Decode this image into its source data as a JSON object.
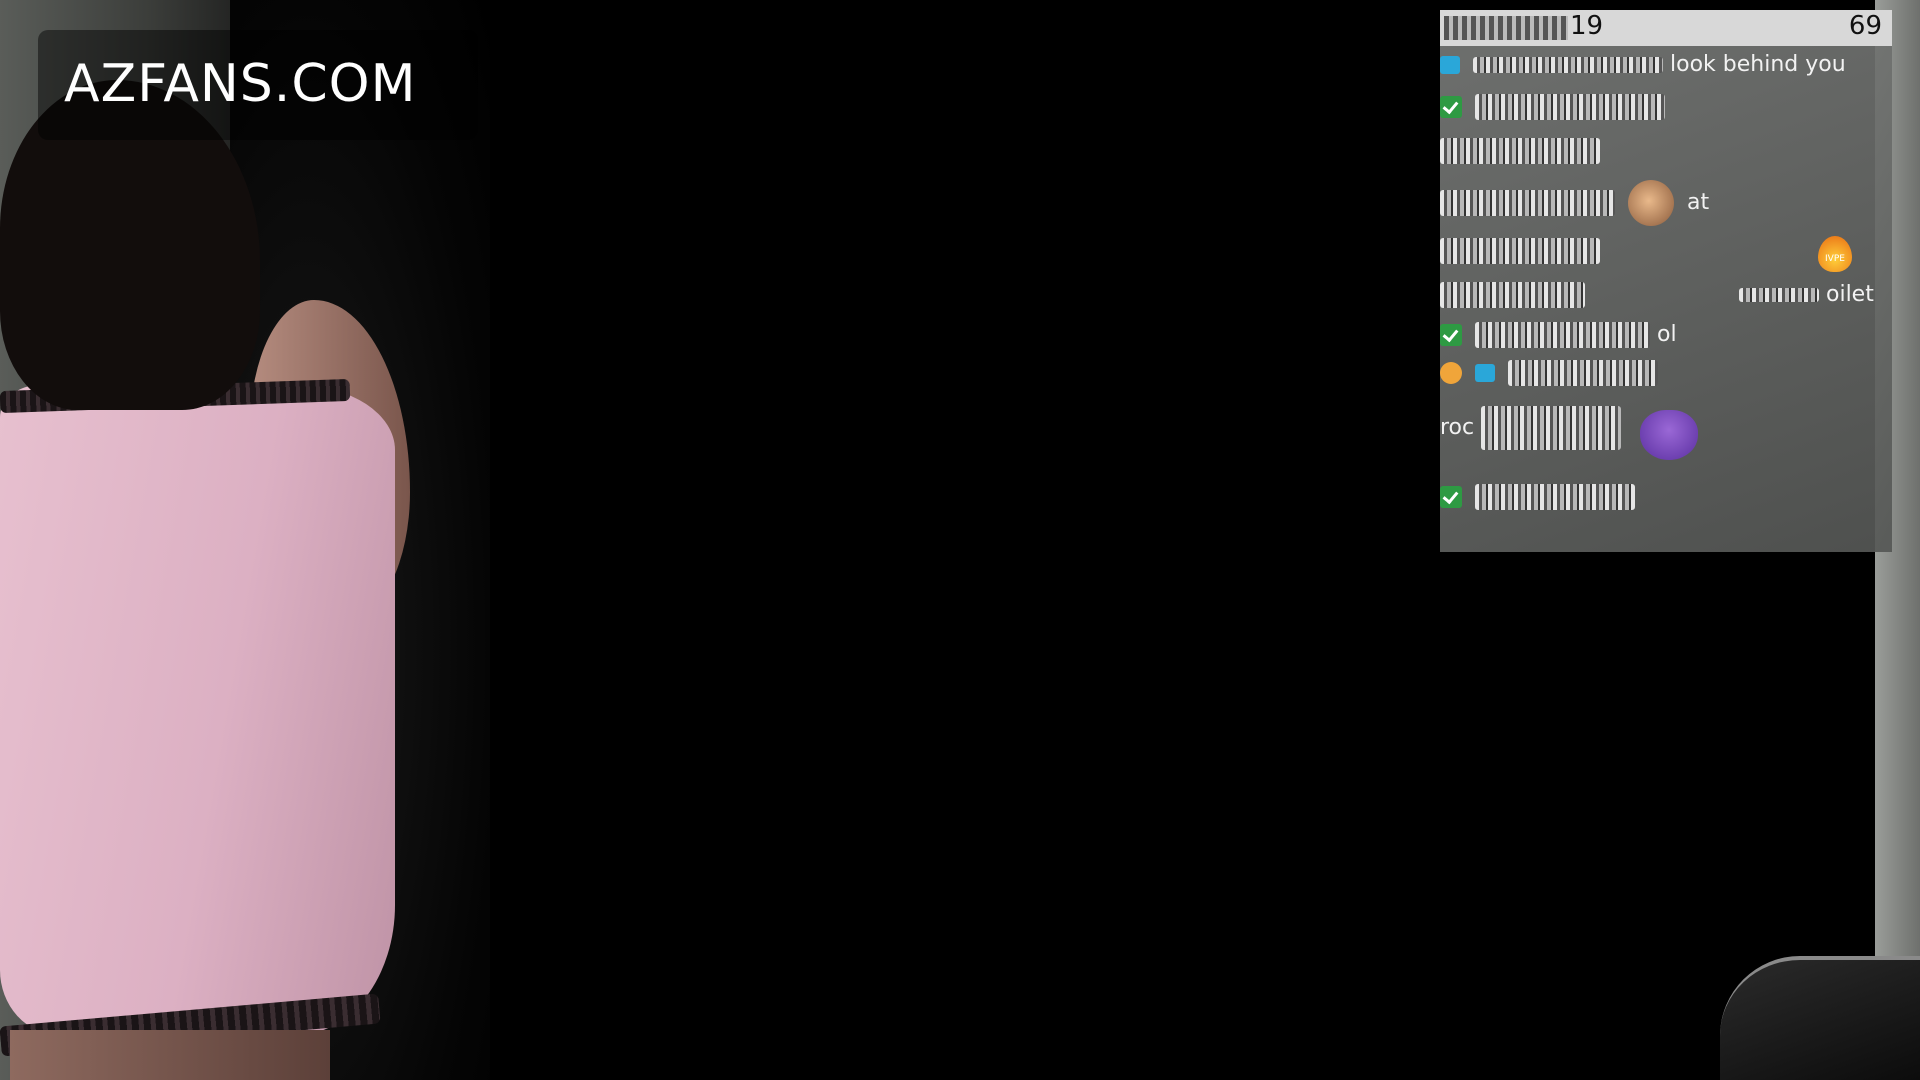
{
  "watermark": {
    "text": "AZFANS.COM"
  },
  "chat_overlay": {
    "topbar": {
      "left_value": "19",
      "right_value": "69"
    },
    "messages": [
      {
        "text": "look behind you"
      },
      {
        "text": ""
      },
      {
        "text": ""
      },
      {
        "text": "at"
      },
      {
        "text": ""
      },
      {
        "text": "oilet"
      },
      {
        "text": "ol"
      },
      {
        "text": ""
      },
      {
        "text": "roc"
      },
      {
        "text": ""
      }
    ],
    "badges": {
      "fire": "IVPE"
    }
  },
  "colors": {
    "dress": "#e2bacb",
    "chat_bg": "#737573",
    "topbar_bg": "#d8d8d8",
    "badge_green": "#2e9a43",
    "badge_blue": "#2aa7d9"
  }
}
